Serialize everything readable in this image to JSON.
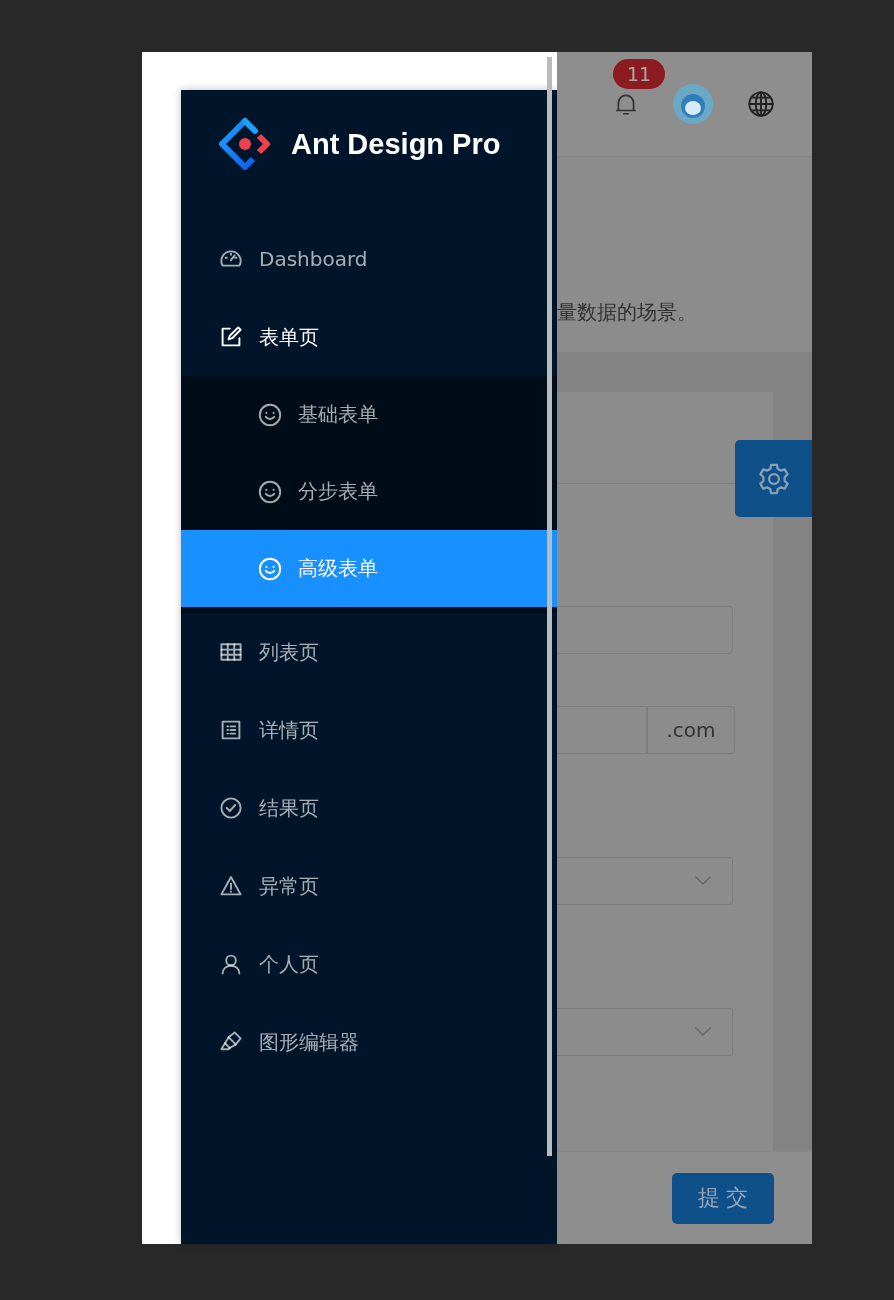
{
  "drawer": {
    "logo_text": "Ant Design Pro",
    "menu": [
      {
        "label": "Dashboard",
        "selected": false
      },
      {
        "label": "表单页",
        "selected": false,
        "expanded": true,
        "children": [
          {
            "label": "基础表单",
            "selected": false
          },
          {
            "label": "分步表单",
            "selected": false
          },
          {
            "label": "高级表单",
            "selected": true
          }
        ]
      },
      {
        "label": "列表页",
        "selected": false
      },
      {
        "label": "详情页",
        "selected": false
      },
      {
        "label": "结果页",
        "selected": false
      },
      {
        "label": "异常页",
        "selected": false
      },
      {
        "label": "个人页",
        "selected": false
      },
      {
        "label": "图形编辑器",
        "selected": false
      }
    ]
  },
  "header": {
    "notification_count": "11"
  },
  "page_header": {
    "description": "量数据的场景。"
  },
  "form": {
    "fields": [
      {
        "kind": "input"
      },
      {
        "kind": "addon",
        "addon": ".com"
      },
      {
        "kind": "select"
      },
      {
        "kind": "select"
      }
    ]
  },
  "footer": {
    "submit_label": "提 交"
  }
}
